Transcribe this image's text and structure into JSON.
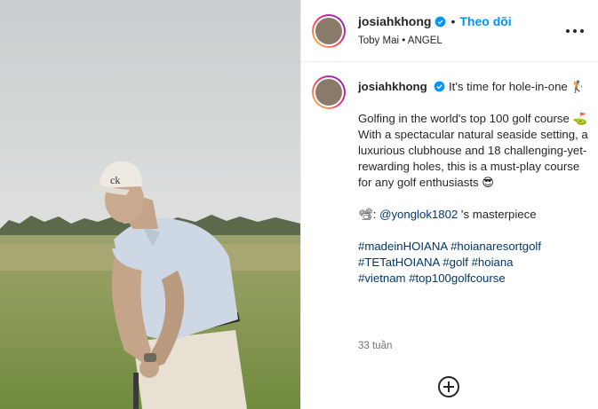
{
  "post_header": {
    "username": "josiahkhong",
    "separator": "•",
    "follow_label": "Theo dõi",
    "subtitle": "Toby Mai • ANGEL",
    "more_icon": "more-options-icon"
  },
  "caption": {
    "username": "josiahkhong",
    "line1": "It's time for hole-in-one 🏌",
    "line2": "Golfing in the world's top 100 golf course ⛳",
    "line3": "With a spectacular natural seaside setting, a luxurious clubhouse and 18 challenging-yet-rewarding holes, this is a must-play course for any golf enthusiasts 😎",
    "credit_emoji": "📽:",
    "credit_handle": "@yonglok1802",
    "credit_suffix": " 's masterpiece",
    "hashtags": [
      "#madeinHOIANA",
      "#hoianaresortgolf",
      "#TETatHOIANA",
      "#golf",
      "#hoiana",
      "#vietnam",
      "#top100golfcourse"
    ],
    "time_ago": "33 tuần"
  },
  "colors": {
    "follow_blue": "#0095f6",
    "hashtag_blue": "#00376b",
    "verified_blue": "#0095f6"
  }
}
